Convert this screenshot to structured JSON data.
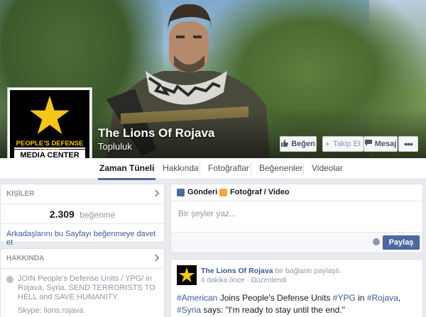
{
  "page": {
    "name": "The Lions Of Rojava",
    "category": "Topluluk",
    "logo_line1": "PEOPLE'S DEFENSE UNITS",
    "logo_line2": "MEDIA CENTER"
  },
  "actions": {
    "like": "Beğen",
    "follow": "Takip Et",
    "message": "Mesaj",
    "more": "•••"
  },
  "tabs": [
    "Zaman Tüneli",
    "Hakkında",
    "Fotoğraflar",
    "Beğenenler",
    "Videolar"
  ],
  "people": {
    "header": "KİŞİLER",
    "likes_count": "2.309",
    "likes_label": "beğenme",
    "invite": "Arkadaşlarını bu Sayfayı beğenmeye davet et"
  },
  "about": {
    "header": "HAKKINDA",
    "text": "JOIN People's Defense Units / YPG/ in Rojava, Syria, SEND TERRORISTS TO HELL and SAVE HUMANITY.",
    "skype": "Skype: lions.rojava"
  },
  "composer": {
    "tab_post": "Gönderi",
    "tab_photo": "Fotoğraf / Video",
    "placeholder": "Bir şeyler yaz...",
    "share": "Paylaş"
  },
  "post": {
    "author": "The Lions Of Rojava",
    "link_text": "bir bağlantı",
    "action": "paylaştı.",
    "time": "4 dakika önce",
    "edited": "Düzenlendi",
    "tag1": "#American",
    "text1": "Joins People's Defense Units",
    "tag2": "#YPG",
    "text2": "in",
    "tag3": "#Rojava",
    "tag4": "#Syria",
    "text3": "says: \"I'm ready to stay until the end.\""
  },
  "colors": {
    "brand": "#4e69a2",
    "link": "#3b5998",
    "logo_gold": "#f5c518"
  }
}
